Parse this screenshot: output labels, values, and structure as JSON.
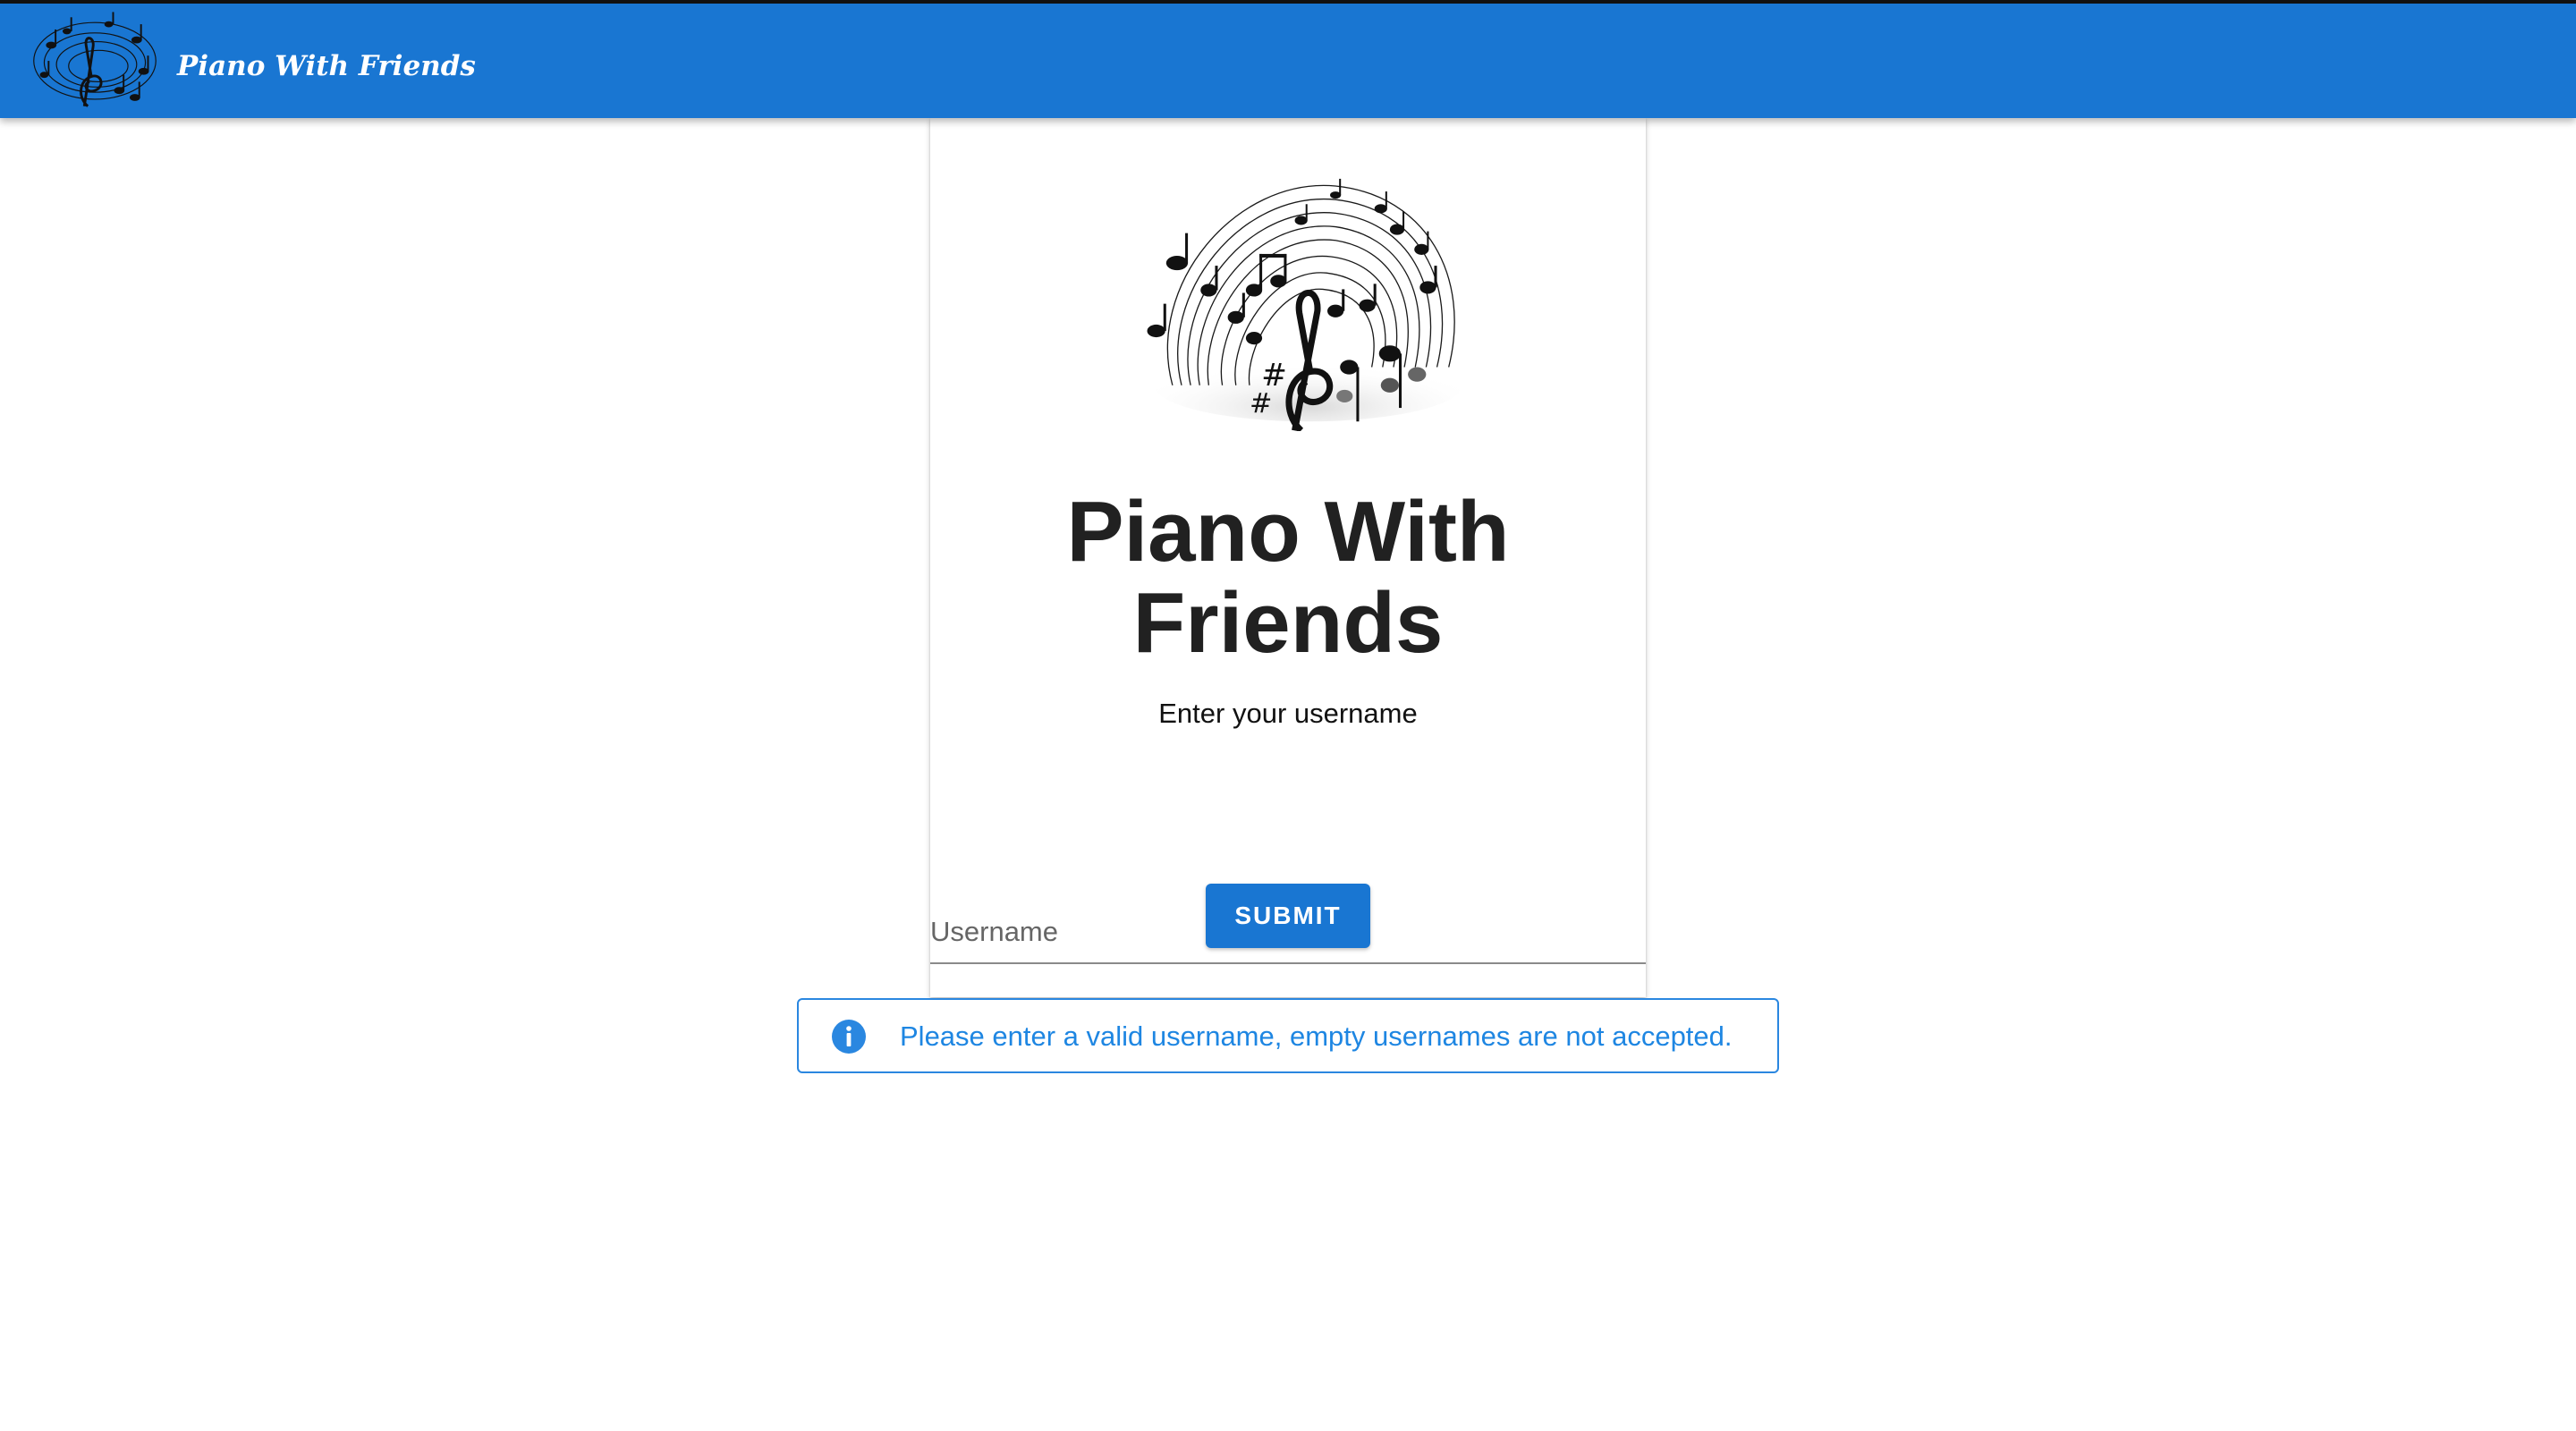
{
  "appbar": {
    "title": "Piano With Friends",
    "logo_icon": "music-notes-swirl-icon",
    "color": "#1976d2"
  },
  "card": {
    "hero_icon": "music-notes-swirl-icon",
    "heading_line1": "Piano With",
    "heading_line2": "Friends",
    "subtitle": "Enter your username"
  },
  "username_field": {
    "label": "Username",
    "value": ""
  },
  "submit": {
    "label": "SUBMIT"
  },
  "alert": {
    "severity": "info",
    "icon": "info-icon",
    "message": "Please enter a valid username, empty usernames are not accepted.",
    "color": "#2a87e0"
  }
}
